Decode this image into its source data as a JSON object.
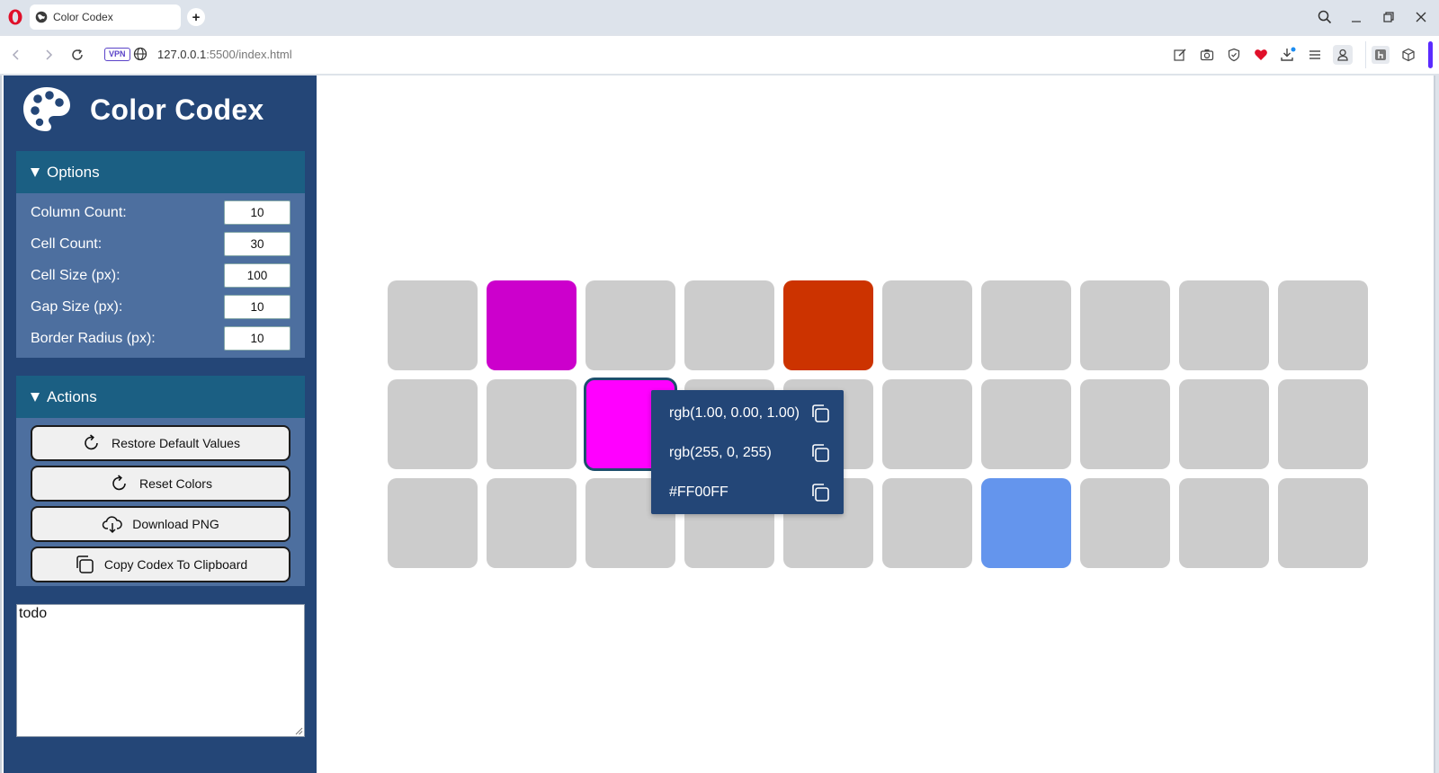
{
  "browser": {
    "tab_title": "Color Codex",
    "url_host": "127.0.0.1",
    "url_rest": ":5500/index.html",
    "vpn_label": "VPN"
  },
  "sidebar": {
    "title": "Color Codex",
    "options": {
      "heading": "Options",
      "rows": [
        {
          "label": "Column Count:",
          "value": "10"
        },
        {
          "label": "Cell Count:",
          "value": "30"
        },
        {
          "label": "Cell Size (px):",
          "value": "100"
        },
        {
          "label": "Gap Size (px):",
          "value": "10"
        },
        {
          "label": "Border Radius (px):",
          "value": "10"
        }
      ]
    },
    "actions": {
      "heading": "Actions",
      "buttons": [
        {
          "label": "Restore Default Values",
          "icon": "refresh-icon"
        },
        {
          "label": "Reset Colors",
          "icon": "refresh-icon"
        },
        {
          "label": "Download PNG",
          "icon": "cloud-download-icon"
        },
        {
          "label": "Copy Codex To Clipboard",
          "icon": "copy-icon"
        }
      ]
    },
    "notes": "todo"
  },
  "grid": {
    "columns": 10,
    "default_color": "#cccccc",
    "cells": [
      {
        "index": 1,
        "color": "#cc00cc"
      },
      {
        "index": 4,
        "color": "#cc3300"
      },
      {
        "index": 12,
        "color": "#ff00ff",
        "selected": true
      },
      {
        "index": 26,
        "color": "#6495ed"
      }
    ]
  },
  "popup": {
    "rows": [
      {
        "text": "rgb(1.00, 0.00, 1.00)"
      },
      {
        "text": "rgb(255, 0, 255)"
      },
      {
        "text": "#FF00FF"
      }
    ]
  },
  "colors": {
    "sidebar_bg": "#244677",
    "panel_header": "#1b5f83",
    "panel_body": "#4d6f9f",
    "popup_bg": "#234677"
  }
}
